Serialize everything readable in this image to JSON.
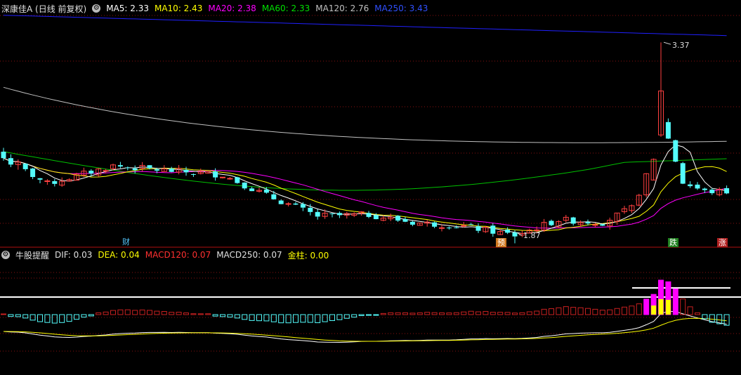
{
  "price_header": {
    "title": "深康佳A (日线 前复权)",
    "ma5": "MA5: 2.33",
    "ma10": "MA10: 2.43",
    "ma20": "MA20: 2.38",
    "ma60": "MA60: 2.33",
    "ma120": "MA120: 2.76",
    "ma250": "MA250: 3.43"
  },
  "macd_header": {
    "title": "牛股提醒",
    "dif": "DIF: 0.03",
    "dea": "DEA: 0.04",
    "macd120": "MACD120: 0.07",
    "macd250": "MACD250: 0.07",
    "jinzhu": "金柱: 0.00"
  },
  "tags": {
    "cai": "财",
    "yu": "预",
    "die": "跌",
    "zhang": "涨"
  },
  "colors": {
    "up": "#ff4040",
    "down": "#54fcfc",
    "ma5": "#ffffff",
    "ma10": "#ffff00",
    "ma20": "#ff00ff",
    "ma60": "#00c000",
    "ma120": "#c0c0c0",
    "ma250": "#2020ff",
    "macd_pos": "#c82020",
    "macd_neg": "#54fcfc",
    "strong": "#ff00ff",
    "gold": "#ffff00"
  },
  "chart_data": [
    {
      "type": "candlestick",
      "title": "深康佳A (日线 前复权)",
      "y_annotations": [
        {
          "label": "3.37",
          "value": 3.37
        },
        {
          "label": "1.87",
          "value": 1.87
        }
      ],
      "ohlc_start": [
        [
          2.52,
          2.55,
          2.45,
          2.47
        ],
        [
          2.47,
          2.5,
          2.4,
          2.42
        ],
        [
          2.42,
          2.46,
          2.38,
          2.44
        ]
      ],
      "series": [
        {
          "name": "MA5",
          "value": 2.33
        },
        {
          "name": "MA10",
          "value": 2.43
        },
        {
          "name": "MA20",
          "value": 2.38
        },
        {
          "name": "MA60",
          "value": 2.33
        },
        {
          "name": "MA120",
          "value": 2.76
        },
        {
          "name": "MA250",
          "value": 3.43
        }
      ]
    },
    {
      "type": "bar",
      "title": "牛股提醒",
      "series": [
        {
          "name": "DIF",
          "value": 0.03
        },
        {
          "name": "DEA",
          "value": 0.04
        },
        {
          "name": "MACD120",
          "value": 0.07
        },
        {
          "name": "MACD250",
          "value": 0.07
        },
        {
          "name": "金柱",
          "value": 0.0
        }
      ]
    }
  ]
}
